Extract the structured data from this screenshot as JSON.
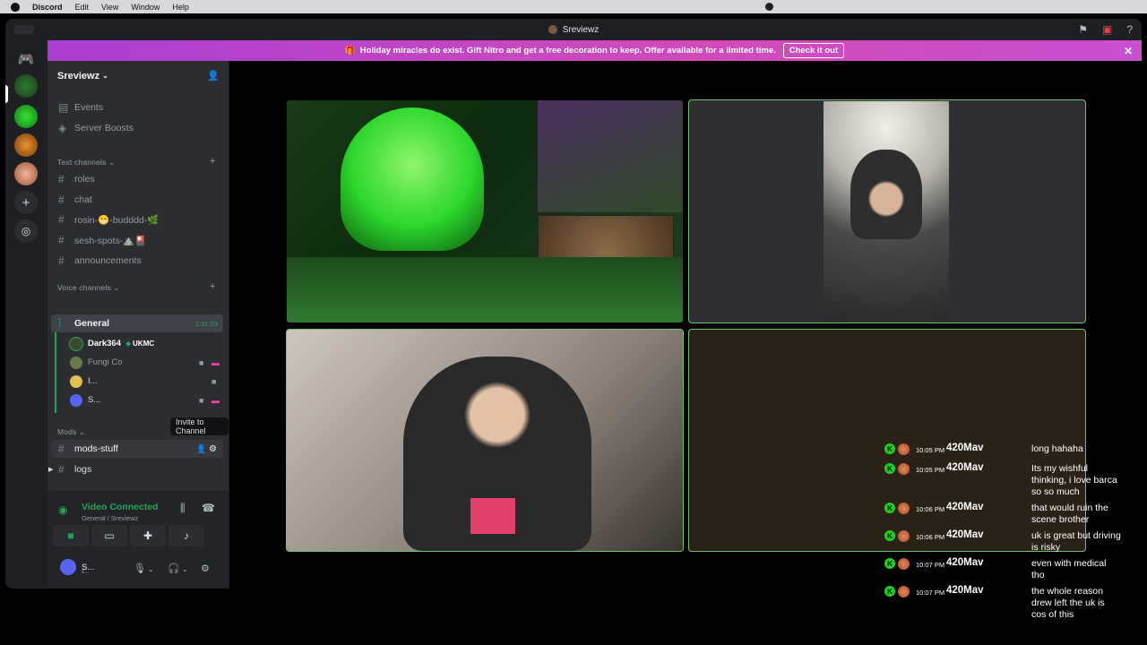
{
  "menubar": {
    "app": "Discord",
    "items": [
      "Edit",
      "View",
      "Window",
      "Help"
    ]
  },
  "window": {
    "title": "Sreviewz"
  },
  "banner": {
    "text": "Holiday miracles do exist. Gift Nitro and get a free decoration to keep. Offer available for a limited time.",
    "button": "Check it out"
  },
  "server": {
    "name": "Sreviewz"
  },
  "sidebar": {
    "top_items": [
      {
        "label": "Events",
        "icon": "calendar-icon"
      },
      {
        "label": "Server Boosts",
        "icon": "boost-icon"
      }
    ],
    "text_category": "Text channels",
    "text_channels": [
      "roles",
      "chat",
      "rosin-😁-budddd-🌿",
      "sesh-spots-⛰️🎴",
      "announcements"
    ],
    "voice_category": "Voice channels",
    "voice_channel": {
      "name": "General",
      "timer": "1:31:03"
    },
    "voice_users": [
      {
        "name": "Dark364",
        "tag": "UKMC"
      },
      {
        "name": "Fungi Co"
      },
      {
        "name": "I..."
      },
      {
        "name": "S..."
      }
    ],
    "mods_category": "Mods",
    "mods_channels": [
      "mods-stuff",
      "logs"
    ],
    "tooltip": "Invite to Channel"
  },
  "voice_panel": {
    "status": "Video Connected",
    "location": "General / Sreviewz"
  },
  "user": {
    "name": "S...",
    "sub": "s..."
  },
  "chat_overlay": [
    {
      "time": "10:05 PM",
      "name": "420Mav",
      "text": "long hahaha"
    },
    {
      "time": "10:05 PM",
      "name": "420Mav",
      "text": "Its my wishful thinking, i love barca so so much"
    },
    {
      "time": "10:06 PM",
      "name": "420Mav",
      "text": "that would ruin the scene brother"
    },
    {
      "time": "10:06 PM",
      "name": "420Mav",
      "text": "uk is great but driving is risky"
    },
    {
      "time": "10:07 PM",
      "name": "420Mav",
      "text": "even with medical tho"
    },
    {
      "time": "10:07 PM",
      "name": "420Mav",
      "text": "the whole reason drew left the uk is cos of this"
    }
  ],
  "colors": {
    "accent_green": "#23a559",
    "banner_purple": "#b842cf",
    "active_tile_border": "#6fbf73"
  }
}
